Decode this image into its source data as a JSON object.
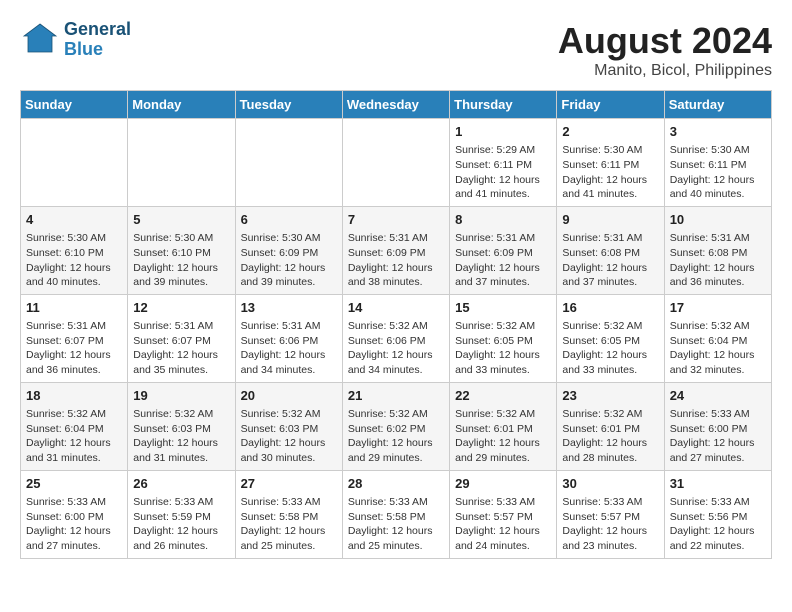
{
  "header": {
    "logo_general": "General",
    "logo_blue": "Blue",
    "title": "August 2024",
    "subtitle": "Manito, Bicol, Philippines"
  },
  "columns": [
    "Sunday",
    "Monday",
    "Tuesday",
    "Wednesday",
    "Thursday",
    "Friday",
    "Saturday"
  ],
  "weeks": [
    [
      {
        "day": "",
        "info": ""
      },
      {
        "day": "",
        "info": ""
      },
      {
        "day": "",
        "info": ""
      },
      {
        "day": "",
        "info": ""
      },
      {
        "day": "1",
        "info": "Sunrise: 5:29 AM\nSunset: 6:11 PM\nDaylight: 12 hours\nand 41 minutes."
      },
      {
        "day": "2",
        "info": "Sunrise: 5:30 AM\nSunset: 6:11 PM\nDaylight: 12 hours\nand 41 minutes."
      },
      {
        "day": "3",
        "info": "Sunrise: 5:30 AM\nSunset: 6:11 PM\nDaylight: 12 hours\nand 40 minutes."
      }
    ],
    [
      {
        "day": "4",
        "info": "Sunrise: 5:30 AM\nSunset: 6:10 PM\nDaylight: 12 hours\nand 40 minutes."
      },
      {
        "day": "5",
        "info": "Sunrise: 5:30 AM\nSunset: 6:10 PM\nDaylight: 12 hours\nand 39 minutes."
      },
      {
        "day": "6",
        "info": "Sunrise: 5:30 AM\nSunset: 6:09 PM\nDaylight: 12 hours\nand 39 minutes."
      },
      {
        "day": "7",
        "info": "Sunrise: 5:31 AM\nSunset: 6:09 PM\nDaylight: 12 hours\nand 38 minutes."
      },
      {
        "day": "8",
        "info": "Sunrise: 5:31 AM\nSunset: 6:09 PM\nDaylight: 12 hours\nand 37 minutes."
      },
      {
        "day": "9",
        "info": "Sunrise: 5:31 AM\nSunset: 6:08 PM\nDaylight: 12 hours\nand 37 minutes."
      },
      {
        "day": "10",
        "info": "Sunrise: 5:31 AM\nSunset: 6:08 PM\nDaylight: 12 hours\nand 36 minutes."
      }
    ],
    [
      {
        "day": "11",
        "info": "Sunrise: 5:31 AM\nSunset: 6:07 PM\nDaylight: 12 hours\nand 36 minutes."
      },
      {
        "day": "12",
        "info": "Sunrise: 5:31 AM\nSunset: 6:07 PM\nDaylight: 12 hours\nand 35 minutes."
      },
      {
        "day": "13",
        "info": "Sunrise: 5:31 AM\nSunset: 6:06 PM\nDaylight: 12 hours\nand 34 minutes."
      },
      {
        "day": "14",
        "info": "Sunrise: 5:32 AM\nSunset: 6:06 PM\nDaylight: 12 hours\nand 34 minutes."
      },
      {
        "day": "15",
        "info": "Sunrise: 5:32 AM\nSunset: 6:05 PM\nDaylight: 12 hours\nand 33 minutes."
      },
      {
        "day": "16",
        "info": "Sunrise: 5:32 AM\nSunset: 6:05 PM\nDaylight: 12 hours\nand 33 minutes."
      },
      {
        "day": "17",
        "info": "Sunrise: 5:32 AM\nSunset: 6:04 PM\nDaylight: 12 hours\nand 32 minutes."
      }
    ],
    [
      {
        "day": "18",
        "info": "Sunrise: 5:32 AM\nSunset: 6:04 PM\nDaylight: 12 hours\nand 31 minutes."
      },
      {
        "day": "19",
        "info": "Sunrise: 5:32 AM\nSunset: 6:03 PM\nDaylight: 12 hours\nand 31 minutes."
      },
      {
        "day": "20",
        "info": "Sunrise: 5:32 AM\nSunset: 6:03 PM\nDaylight: 12 hours\nand 30 minutes."
      },
      {
        "day": "21",
        "info": "Sunrise: 5:32 AM\nSunset: 6:02 PM\nDaylight: 12 hours\nand 29 minutes."
      },
      {
        "day": "22",
        "info": "Sunrise: 5:32 AM\nSunset: 6:01 PM\nDaylight: 12 hours\nand 29 minutes."
      },
      {
        "day": "23",
        "info": "Sunrise: 5:32 AM\nSunset: 6:01 PM\nDaylight: 12 hours\nand 28 minutes."
      },
      {
        "day": "24",
        "info": "Sunrise: 5:33 AM\nSunset: 6:00 PM\nDaylight: 12 hours\nand 27 minutes."
      }
    ],
    [
      {
        "day": "25",
        "info": "Sunrise: 5:33 AM\nSunset: 6:00 PM\nDaylight: 12 hours\nand 27 minutes."
      },
      {
        "day": "26",
        "info": "Sunrise: 5:33 AM\nSunset: 5:59 PM\nDaylight: 12 hours\nand 26 minutes."
      },
      {
        "day": "27",
        "info": "Sunrise: 5:33 AM\nSunset: 5:58 PM\nDaylight: 12 hours\nand 25 minutes."
      },
      {
        "day": "28",
        "info": "Sunrise: 5:33 AM\nSunset: 5:58 PM\nDaylight: 12 hours\nand 25 minutes."
      },
      {
        "day": "29",
        "info": "Sunrise: 5:33 AM\nSunset: 5:57 PM\nDaylight: 12 hours\nand 24 minutes."
      },
      {
        "day": "30",
        "info": "Sunrise: 5:33 AM\nSunset: 5:57 PM\nDaylight: 12 hours\nand 23 minutes."
      },
      {
        "day": "31",
        "info": "Sunrise: 5:33 AM\nSunset: 5:56 PM\nDaylight: 12 hours\nand 22 minutes."
      }
    ]
  ]
}
